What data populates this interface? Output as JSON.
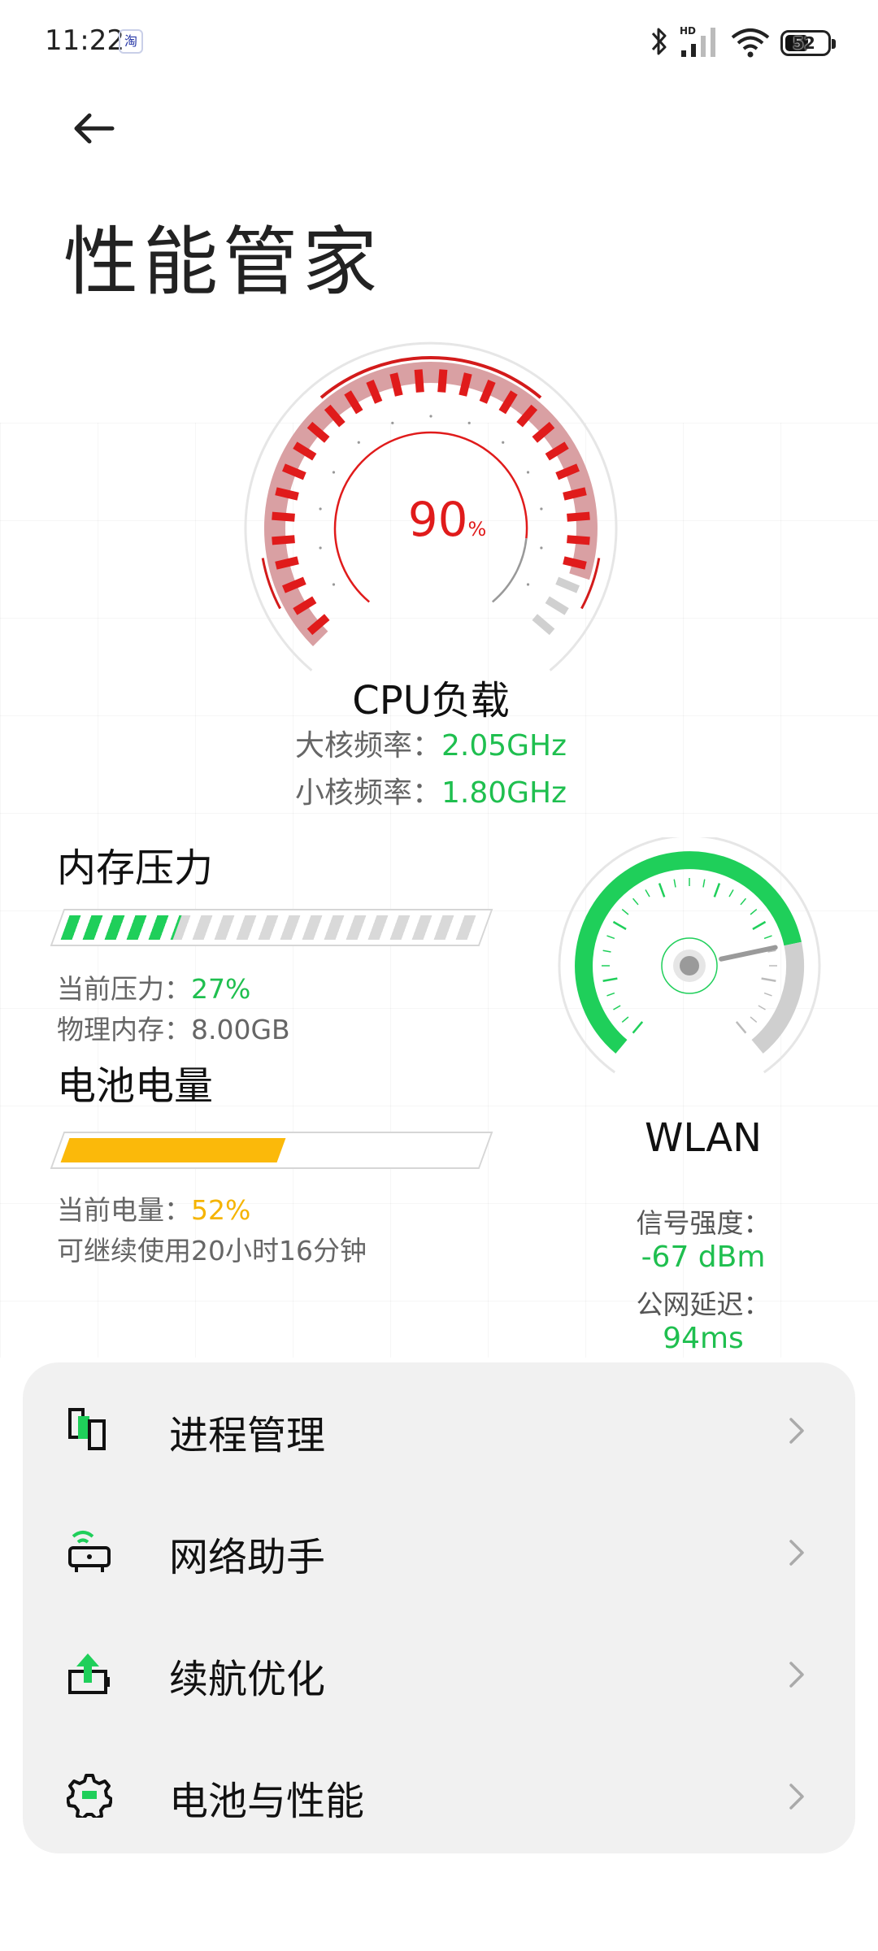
{
  "status_bar": {
    "time": "11:22",
    "app_badge": "淘",
    "battery_level": "52",
    "icons": [
      "taobao-icon",
      "bluetooth-icon",
      "hd-signal-icon",
      "wifi-icon",
      "battery-icon"
    ]
  },
  "header": {
    "title": "性能管家",
    "back_icon": "arrow-left-icon"
  },
  "cpu": {
    "load_value": "90",
    "load_unit": "%",
    "load_fraction": 0.9,
    "label": "CPU负载",
    "big_core_label": "大核频率：",
    "big_core_value": "2.05GHz",
    "small_core_label": "小核频率：",
    "small_core_value": "1.80GHz",
    "color": "#e01b1b"
  },
  "memory": {
    "title": "内存压力",
    "pressure_fraction": 0.27,
    "pressure_label": "当前压力：",
    "pressure_value": "27%",
    "physical_label": "物理内存：",
    "physical_value": "8.00GB",
    "color": "#1fcf5a"
  },
  "battery": {
    "title": "电池电量",
    "level_fraction": 0.52,
    "current_label": "当前电量：",
    "current_value": "52%",
    "remaining_text": "可继续使用20小时16分钟",
    "color": "#fbb90a"
  },
  "wlan": {
    "label": "WLAN",
    "signal_label": "信号强度：",
    "signal_value": "-67 dBm",
    "latency_label": "公网延迟：",
    "latency_value": "94ms",
    "color": "#1fcf5a"
  },
  "menu": {
    "items": [
      {
        "label": "进程管理",
        "icon": "process-manage-icon"
      },
      {
        "label": "网络助手",
        "icon": "router-icon"
      },
      {
        "label": "续航优化",
        "icon": "battery-upload-icon"
      },
      {
        "label": "电池与性能",
        "icon": "gear-icon"
      }
    ],
    "chevron_icon": "chevron-right-icon"
  }
}
